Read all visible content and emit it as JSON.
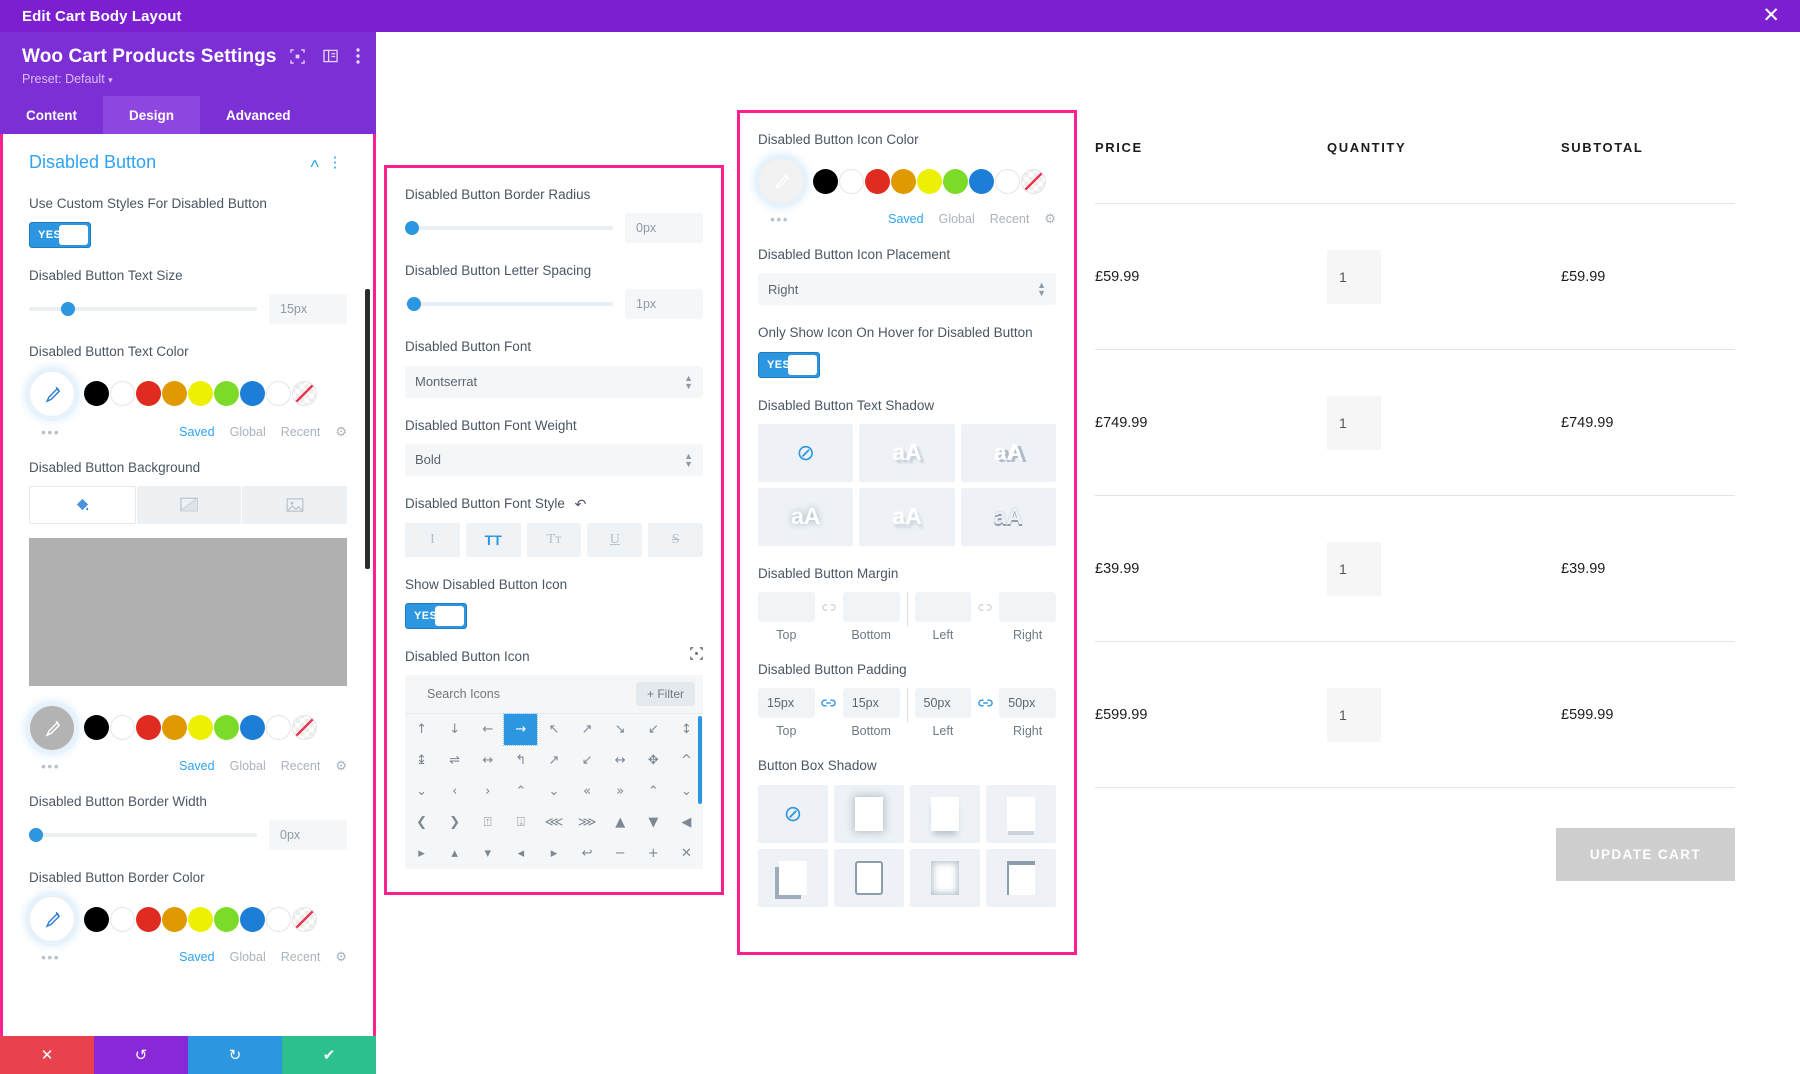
{
  "window": {
    "title": "Edit Cart Body Layout",
    "close_icon": "close-icon"
  },
  "modal": {
    "title": "Woo Cart Products Settings",
    "preset": "Preset: Default",
    "head_icons": [
      "focus-icon",
      "layout-icon",
      "more-vertical-icon"
    ],
    "tabs": [
      {
        "label": "Content",
        "active": false
      },
      {
        "label": "Design",
        "active": true
      },
      {
        "label": "Advanced",
        "active": false
      }
    ]
  },
  "palette": {
    "colors": [
      "#000000",
      "#ffffff",
      "#e02b20",
      "#e09900",
      "#edf000",
      "#7cdb28",
      "#1c7ed6",
      "#ffffff"
    ],
    "transparent_label": "transparent-swatch",
    "links": {
      "saved": "Saved",
      "global": "Global",
      "recent": "Recent",
      "gear": "gear-icon"
    },
    "dots": "•••"
  },
  "left_panel": {
    "section_title": "Disabled Button",
    "fields": {
      "use_custom_styles": {
        "label": "Use Custom Styles For Disabled Button",
        "toggle": "YES"
      },
      "text_size": {
        "label": "Disabled Button Text Size",
        "value": "15px",
        "slider_pct": 14
      },
      "text_color": {
        "label": "Disabled Button Text Color"
      },
      "background": {
        "label": "Disabled Button Background",
        "tabs": [
          "fill-icon",
          "gradient-icon",
          "image-icon"
        ],
        "active_tab": 0
      },
      "bg_color": {
        "label": ""
      },
      "border_width": {
        "label": "Disabled Button Border Width",
        "value": "0px",
        "slider_pct": 0
      },
      "border_color": {
        "label": "Disabled Button Border Color"
      }
    }
  },
  "mid_panel": {
    "border_radius": {
      "label": "Disabled Button Border Radius",
      "value": "0px",
      "slider_pct": 0
    },
    "letter_spacing": {
      "label": "Disabled Button Letter Spacing",
      "value": "1px",
      "slider_pct": 1
    },
    "font": {
      "label": "Disabled Button Font",
      "value": "Montserrat"
    },
    "font_weight": {
      "label": "Disabled Button Font Weight",
      "value": "Bold"
    },
    "font_style": {
      "label": "Disabled Button Font Style",
      "reset_icon": "reset-icon",
      "buttons": [
        {
          "name": "italic",
          "glyph": "I",
          "on": false
        },
        {
          "name": "uppercase",
          "glyph": "TT",
          "on": true
        },
        {
          "name": "smallcaps",
          "glyph": "Tᴛ",
          "on": false
        },
        {
          "name": "underline",
          "glyph": "U",
          "on": false
        },
        {
          "name": "strikethrough",
          "glyph": "S",
          "on": false
        }
      ]
    },
    "show_icon": {
      "label": "Show Disabled Button Icon",
      "toggle": "YES"
    },
    "icon_picker": {
      "label": "Disabled Button Icon",
      "target_icon": "focus-icon",
      "search_placeholder": "Search Icons",
      "filter_label": "+ Filter",
      "selected_index": 3,
      "glyphs": [
        "↑",
        "↓",
        "←",
        "→",
        "↖",
        "↗",
        "↘",
        "↙",
        "↕",
        "↨",
        "⇌",
        "↔",
        "↰",
        "↗",
        "↙",
        "↔",
        "✥",
        "^",
        "⌄",
        "‹",
        "›",
        "⌃",
        "⌄",
        "«",
        "»",
        "⌃",
        "⌄",
        "❮",
        "❯",
        "⍐",
        "⍗",
        "⋘",
        "⋙",
        "▲",
        "▼",
        "◀",
        "▸",
        "▴",
        "▾",
        "◂",
        "▸",
        "↩",
        "−",
        "+",
        "✕"
      ]
    }
  },
  "right_panel": {
    "icon_color": {
      "label": "Disabled Button Icon Color"
    },
    "icon_placement": {
      "label": "Disabled Button Icon Placement",
      "value": "Right"
    },
    "only_hover": {
      "label": "Only Show Icon On Hover for Disabled Button",
      "toggle": "YES"
    },
    "text_shadow": {
      "label": "Disabled Button Text Shadow",
      "options": [
        "none",
        "shadow-bottom-right",
        "shadow-strong-right",
        "shadow-blur",
        "shadow-soft",
        "shadow-outline"
      ]
    },
    "margin": {
      "label": "Disabled Button Margin",
      "values": [
        "",
        "",
        "",
        ""
      ],
      "labels": [
        "Top",
        "Bottom",
        "Left",
        "Right"
      ],
      "link_left": false,
      "link_right": false
    },
    "padding": {
      "label": "Disabled Button Padding",
      "values": [
        "15px",
        "15px",
        "50px",
        "50px"
      ],
      "labels": [
        "Top",
        "Bottom",
        "Left",
        "Right"
      ],
      "link_left": true,
      "link_right": true
    },
    "box_shadow": {
      "label": "Button Box Shadow",
      "options": [
        "none",
        "shadow-outer-soft",
        "shadow-outer-bottom",
        "shadow-bottom-line",
        "shadow-corner-bl",
        "shadow-frame",
        "shadow-inner",
        "shadow-top-line"
      ]
    }
  },
  "cart": {
    "columns": [
      "PRICE",
      "QUANTITY",
      "SUBTOTAL"
    ],
    "rows": [
      {
        "price": "£59.99",
        "qty": "1",
        "subtotal": "£59.99"
      },
      {
        "price": "£749.99",
        "qty": "1",
        "subtotal": "£749.99"
      },
      {
        "price": "£39.99",
        "qty": "1",
        "subtotal": "£39.99"
      },
      {
        "price": "£599.99",
        "qty": "1",
        "subtotal": "£599.99"
      }
    ],
    "update_button": "UPDATE CART"
  },
  "fab": {
    "label": "•••"
  },
  "actionbar": {
    "buttons": [
      {
        "name": "discard",
        "glyph": "✕",
        "color": "red"
      },
      {
        "name": "undo",
        "glyph": "↺",
        "color": "purple"
      },
      {
        "name": "redo",
        "glyph": "↻",
        "color": "blue"
      },
      {
        "name": "save",
        "glyph": "✔",
        "color": "green"
      }
    ]
  }
}
